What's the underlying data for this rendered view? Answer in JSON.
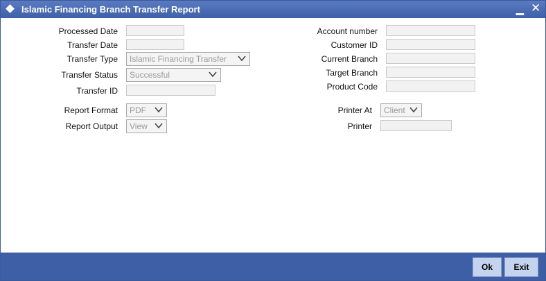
{
  "window": {
    "title": "Islamic Financing Branch Transfer Report",
    "minimize_label": "▁",
    "close_label": "✕"
  },
  "left_fields": {
    "processed_date": "Processed Date",
    "transfer_date": "Transfer Date",
    "transfer_type": "Transfer Type",
    "transfer_type_value": "Islamic Financing Transfer",
    "transfer_status": "Transfer Status",
    "transfer_status_value": "Successful",
    "transfer_id": "Transfer ID"
  },
  "right_fields": {
    "account_number": "Account number",
    "customer_id": "Customer ID",
    "current_branch": "Current Branch",
    "target_branch": "Target Branch",
    "product_code": "Product Code"
  },
  "report": {
    "format_label": "Report Format",
    "format_value": "PDF",
    "output_label": "Report Output",
    "output_value": "View",
    "printer_at_label": "Printer At",
    "printer_at_value": "Client",
    "printer_label": "Printer"
  },
  "footer": {
    "ok_label": "Ok",
    "exit_label": "Exit"
  },
  "colors": {
    "titlebar": "#3e60a8",
    "footer": "#3e5ea6",
    "button": "#c5d4ee"
  }
}
